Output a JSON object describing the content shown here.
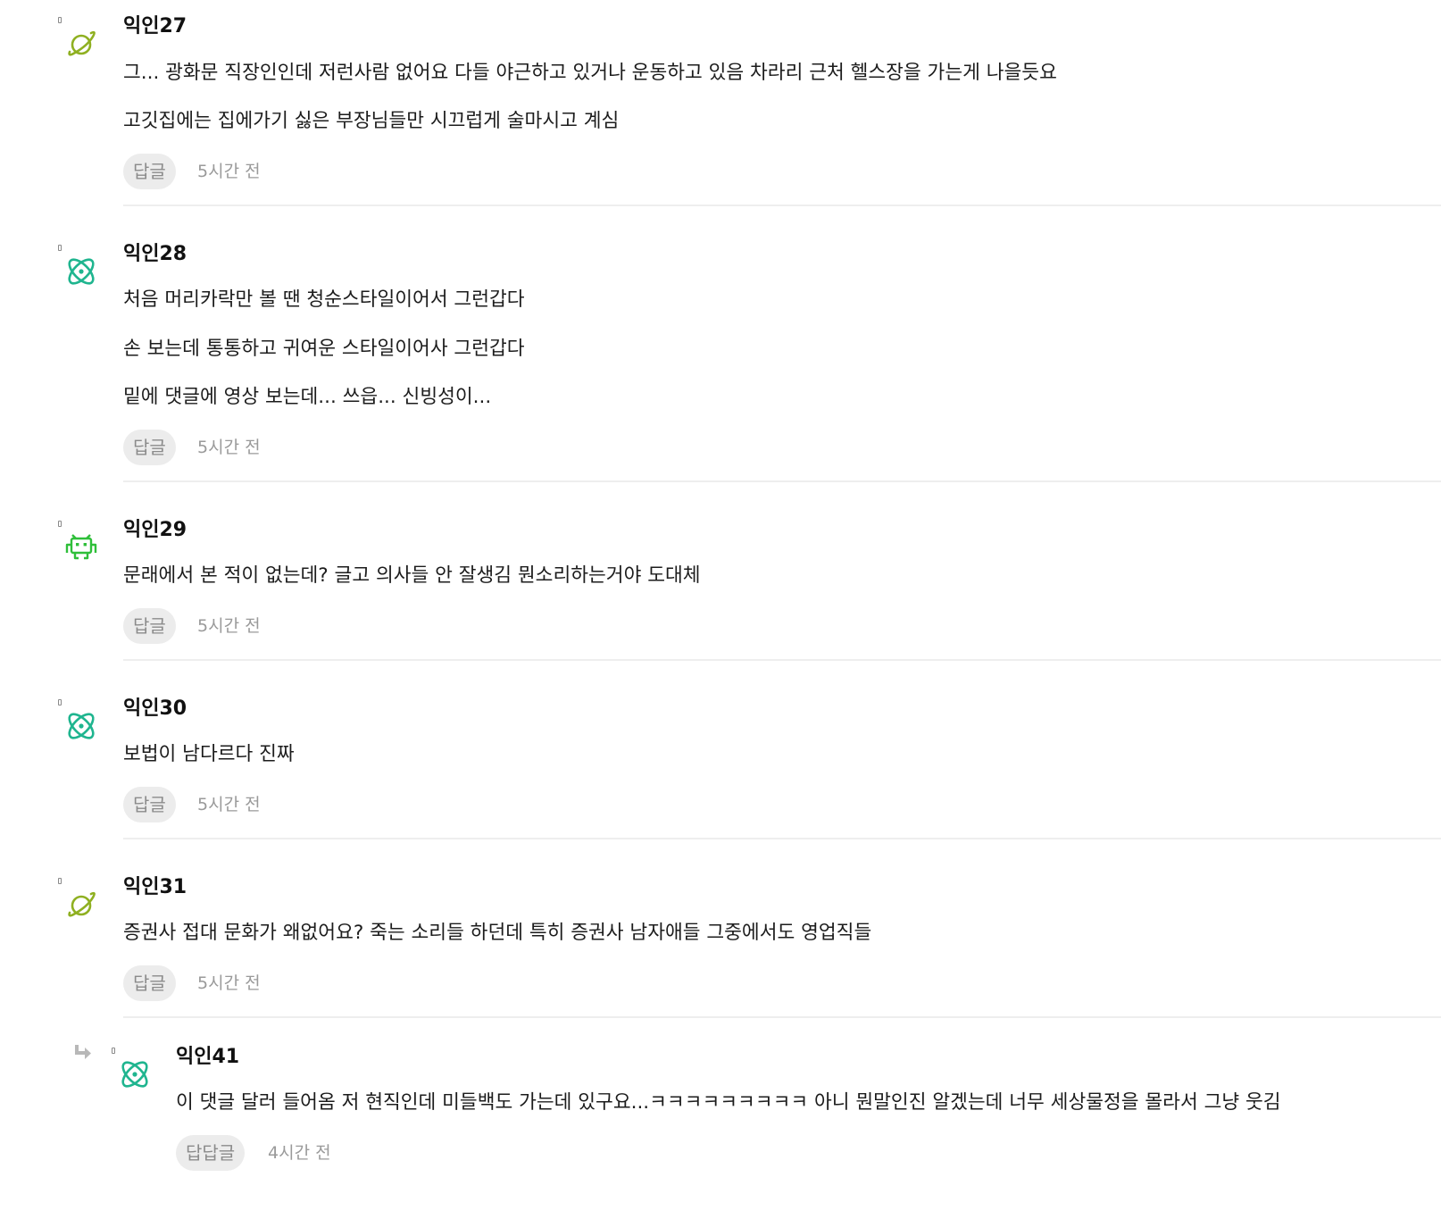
{
  "comments": [
    {
      "author": "익인27",
      "lines": [
        "그... 광화문 직장인인데 저런사람 없어요 다들 야근하고 있거나 운동하고 있음 차라리 근처 헬스장을 가는게 나을듯요",
        "고깃집에는 집에가기 싫은 부장님들만 시끄럽게 술마시고 계심"
      ],
      "reply_label": "답글",
      "time": "5시간 전",
      "avatar_icon": "planet-icon",
      "avatar_color": "#8fb021"
    },
    {
      "author": "익인28",
      "lines": [
        "처음 머리카락만 볼 땐 청순스타일이어서 그런갑다",
        "손 보는데 통통하고 귀여운 스타일이어사 그런갑다",
        "밑에 댓글에 영상 보는데... 쓰읍... 신빙성이..."
      ],
      "reply_label": "답글",
      "time": "5시간 전",
      "avatar_icon": "atom-icon",
      "avatar_color": "#1fb58f"
    },
    {
      "author": "익인29",
      "lines": [
        "문래에서 본 적이 없는데? 글고 의사들 안 잘생김 뭔소리하는거야 도대체"
      ],
      "reply_label": "답글",
      "time": "5시간 전",
      "avatar_icon": "space-invader-icon",
      "avatar_color": "#2fbf3a"
    },
    {
      "author": "익인30",
      "lines": [
        "보법이 남다르다 진짜"
      ],
      "reply_label": "답글",
      "time": "5시간 전",
      "avatar_icon": "atom-icon",
      "avatar_color": "#1fb58f"
    },
    {
      "author": "익인31",
      "lines": [
        "증권사 접대 문화가 왜없어요? 죽는 소리들 하던데 특히 증권사 남자애들 그중에서도 영업직들"
      ],
      "reply_label": "답글",
      "time": "5시간 전",
      "avatar_icon": "planet-icon",
      "avatar_color": "#8fb021"
    }
  ],
  "replies": [
    {
      "author": "익인41",
      "lines": [
        "이 댓글 달러 들어옴 저 현직인데 미들백도 가는데 있구요...ㅋㅋㅋㅋㅋㅋㅋㅋㅋ 아니 뭔말인진 알겠는데 너무 세상물정을 몰라서 그냥 웃김"
      ],
      "reply_label": "답답글",
      "time": "4시간 전",
      "avatar_icon": "atom-icon",
      "avatar_color": "#1fb58f",
      "arrow_icon": "reply-arrow-icon"
    }
  ]
}
